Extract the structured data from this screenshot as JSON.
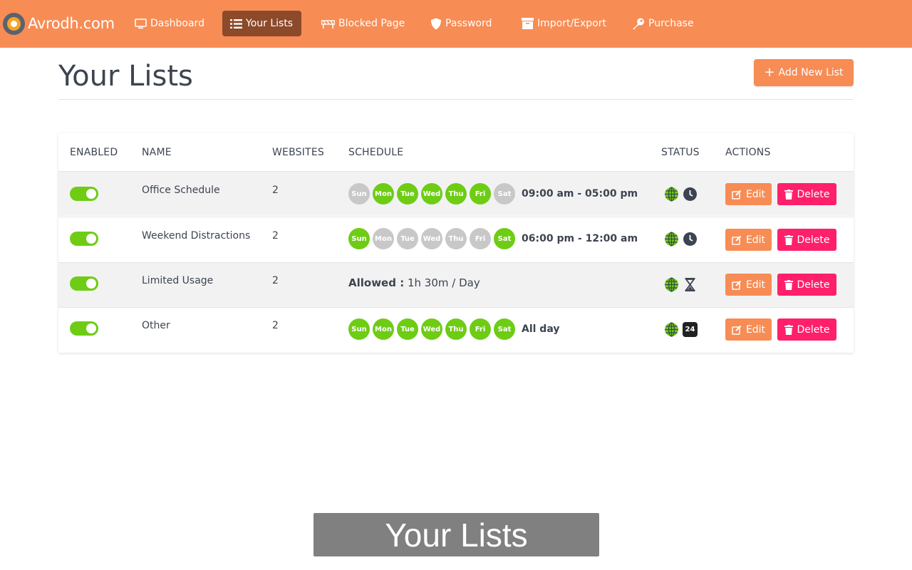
{
  "navbar": {
    "brand": "Avrodh.com",
    "items": [
      {
        "label": "Dashboard",
        "icon": "monitor-icon"
      },
      {
        "label": "Your Lists",
        "icon": "list-icon",
        "active": true
      },
      {
        "label": "Blocked Page",
        "icon": "barrier-icon"
      },
      {
        "label": "Password",
        "icon": "shield-icon"
      },
      {
        "label": "Import/Export",
        "icon": "archive-icon"
      },
      {
        "label": "Purchase",
        "icon": "key-icon"
      }
    ]
  },
  "header": {
    "title": "Your Lists",
    "add_button": "Add New List"
  },
  "table": {
    "columns": [
      "ENABLED",
      "NAME",
      "WEBSITES",
      "SCHEDULE",
      "STATUS",
      "ACTIONS"
    ],
    "edit_label": "Edit",
    "delete_label": "Delete",
    "day_labels": [
      "Sun",
      "Mon",
      "Tue",
      "Wed",
      "Thu",
      "Fri",
      "Sat"
    ],
    "rows": [
      {
        "enabled": true,
        "name": "Office Schedule",
        "websites": "2",
        "days": [
          false,
          true,
          true,
          true,
          true,
          true,
          false
        ],
        "time": "09:00 am - 05:00 pm",
        "status_icon": "clock-icon"
      },
      {
        "enabled": true,
        "name": "Weekend Distractions",
        "websites": "2",
        "days": [
          true,
          false,
          false,
          false,
          false,
          false,
          true
        ],
        "time": "06:00 pm - 12:00 am",
        "status_icon": "clock-icon"
      },
      {
        "enabled": true,
        "name": "Limited Usage",
        "websites": "2",
        "allowed_label": "Allowed :",
        "allowed_value": "1h 30m / Day",
        "status_icon": "hourglass-icon"
      },
      {
        "enabled": true,
        "name": "Other",
        "websites": "2",
        "days": [
          true,
          true,
          true,
          true,
          true,
          true,
          true
        ],
        "time": "All day",
        "status_icon": "24-hours-icon",
        "badge": "24"
      }
    ]
  },
  "caption": "Your Lists",
  "colors": {
    "navbar": "#f78c55",
    "nav_active": "#8c4a2a",
    "toggle_on": "#6ecc15",
    "day_on": "#6ecc15",
    "day_off": "#c8c8c8",
    "delete": "#ff1f6a"
  }
}
